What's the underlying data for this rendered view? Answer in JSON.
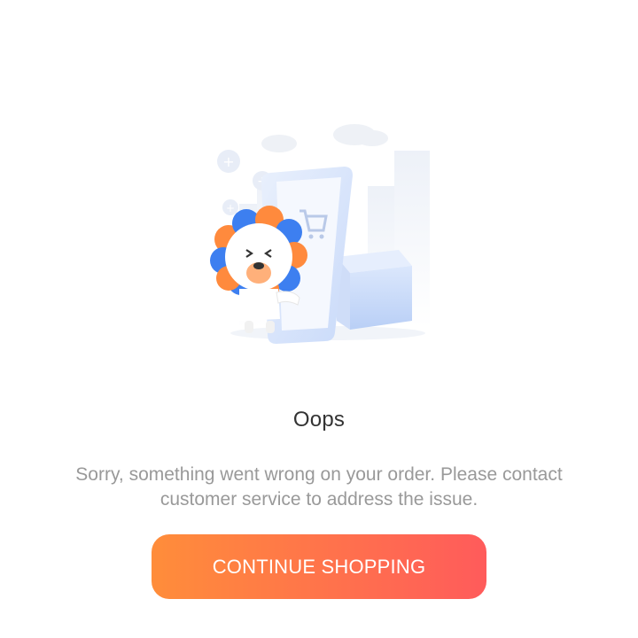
{
  "illustration": {
    "icon": "empty-cart-mascot-illustration",
    "colors": {
      "blue": "#3d7ff0",
      "orange": "#ff8a3d",
      "phone": "#d8e5fb",
      "box": "#c5d8fa"
    }
  },
  "status": {
    "title": "Oops",
    "message": "Sorry, something went wrong on your order. Please contact customer service to address the issue."
  },
  "actions": {
    "continue_label": "CONTINUE SHOPPING"
  },
  "theme": {
    "gradient_start": "#ff8d3a",
    "gradient_end": "#ff5b5b"
  }
}
